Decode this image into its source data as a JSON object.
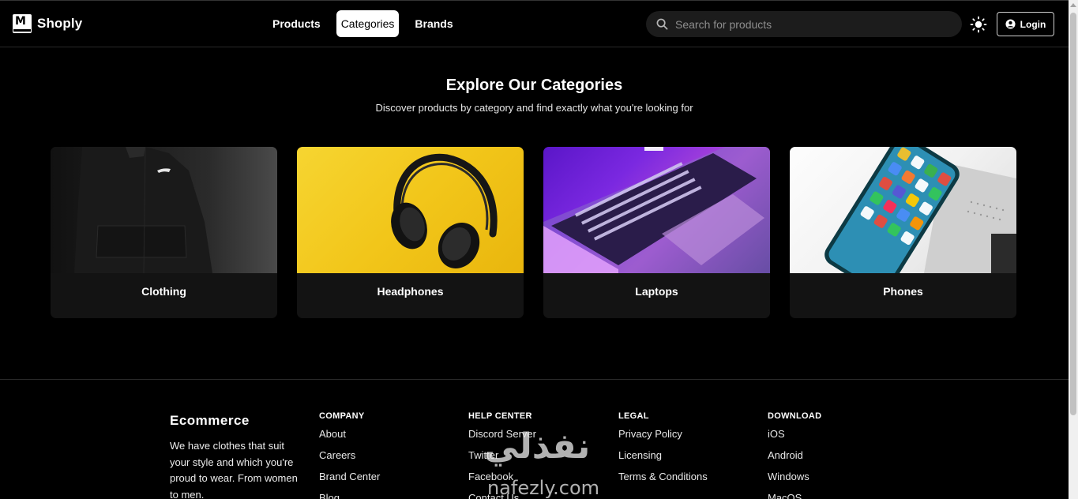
{
  "app": {
    "name": "Shoply"
  },
  "nav": {
    "items": [
      {
        "label": "Products",
        "active": false
      },
      {
        "label": "Categories",
        "active": true
      },
      {
        "label": "Brands",
        "active": false
      }
    ]
  },
  "search": {
    "placeholder": "Search for products",
    "value": ""
  },
  "header": {
    "login_label": "Login",
    "theme_icon": "sun-icon"
  },
  "main": {
    "title": "Explore Our Categories",
    "subtitle": "Discover products by category and find exactly what you're looking for",
    "categories": [
      {
        "label": "Clothing"
      },
      {
        "label": "Headphones"
      },
      {
        "label": "Laptops"
      },
      {
        "label": "Phones"
      }
    ]
  },
  "footer": {
    "brand": {
      "title": "Ecommerce",
      "description": "We have clothes that suit your style and which you're proud to wear. From women to men."
    },
    "columns": [
      {
        "title": "COMPANY",
        "links": [
          "About",
          "Careers",
          "Brand Center",
          "Blog"
        ]
      },
      {
        "title": "HELP CENTER",
        "links": [
          "Discord Server",
          "Twitter",
          "Facebook",
          "Contact Us"
        ]
      },
      {
        "title": "LEGAL",
        "links": [
          "Privacy Policy",
          "Licensing",
          "Terms & Conditions"
        ]
      },
      {
        "title": "DOWNLOAD",
        "links": [
          "iOS",
          "Android",
          "Windows",
          "MacOS"
        ]
      }
    ]
  },
  "watermark": {
    "text": "نفذلي",
    "url": "nafezly.com"
  }
}
